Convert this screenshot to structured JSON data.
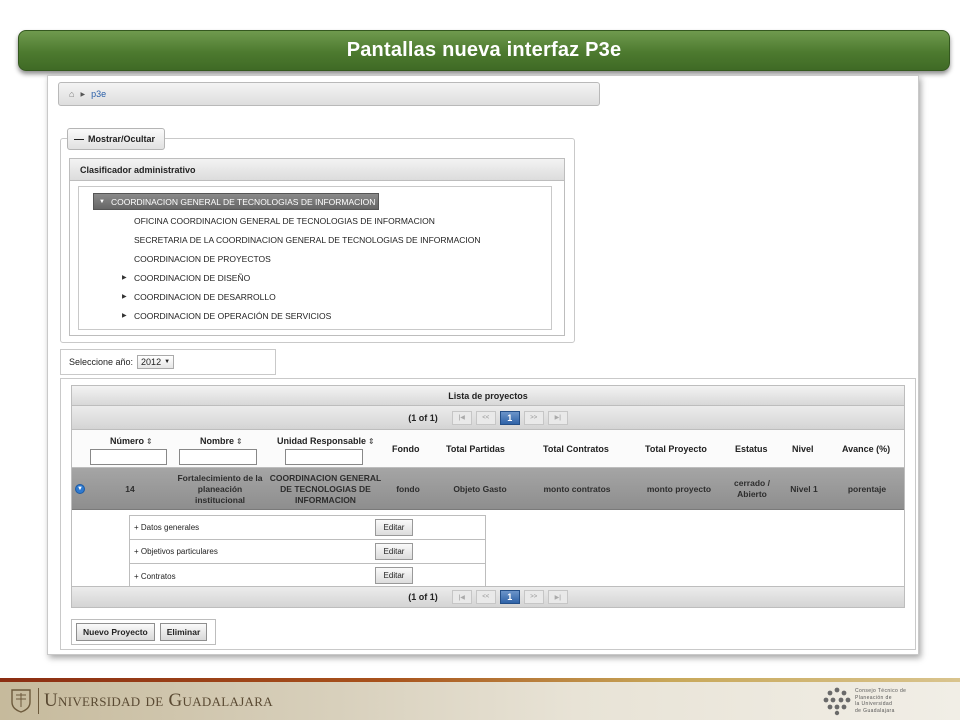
{
  "slide": {
    "title": "Pantallas nueva interfaz P3e",
    "footer_university": "Universidad de Guadalajara",
    "footer_logo_lines": [
      "Consejo Técnico de",
      "Planeación de",
      "la Universidad",
      "de Guadalajara"
    ]
  },
  "breadcrumb": {
    "home_icon": "home-icon",
    "current": "p3e"
  },
  "toggle": {
    "label": "Mostrar/Ocultar"
  },
  "clasificador": {
    "header": "Clasificador administrativo",
    "root": "COORDINACION GENERAL DE TECNOLOGIAS DE INFORMACION",
    "items": [
      {
        "label": "OFICINA COORDINACION GENERAL DE TECNOLOGIAS DE INFORMACION",
        "expandable": false
      },
      {
        "label": "SECRETARIA DE LA COORDINACION GENERAL DE TECNOLOGIAS DE INFORMACION",
        "expandable": false
      },
      {
        "label": "COORDINACION DE PROYECTOS",
        "expandable": false
      },
      {
        "label": "COORDINACION DE DISEÑO",
        "expandable": true
      },
      {
        "label": "COORDINACION DE DESARROLLO",
        "expandable": true
      },
      {
        "label": "COORDINACION DE OPERACIÓN DE SERVICIOS",
        "expandable": true
      }
    ]
  },
  "year": {
    "label": "Seleccione año:",
    "value": "2012"
  },
  "projects": {
    "title": "Lista de proyectos",
    "pager": {
      "text": "(1 of 1)",
      "current_page": "1"
    },
    "columns": [
      "Número",
      "Nombre",
      "Unidad Responsable",
      "Fondo",
      "Total Partidas",
      "Total Contratos",
      "Total Proyecto",
      "Estatus",
      "Nivel",
      "Avance (%)"
    ],
    "row": {
      "numero": "14",
      "nombre": "Fortalecimiento de la planeación institucional",
      "unidad": "COORDINACION GENERAL DE TECNOLOGIAS DE INFORMACION",
      "fondo": "fondo",
      "total_partidas": "Objeto Gasto",
      "total_contratos": "monto contratos",
      "total_proyecto": "monto proyecto",
      "estatus": "cerrado / Abierto",
      "nivel": "Nivel 1",
      "avance": "porentaje"
    },
    "subrows": [
      {
        "label": "+ Datos generales",
        "button": "Editar"
      },
      {
        "label": "+ Objetivos particulares",
        "button": "Editar"
      },
      {
        "label": "+ Contratos",
        "button": "Editar"
      }
    ]
  },
  "actions": {
    "new_project": "Nuevo Proyecto",
    "delete": "Eliminar"
  }
}
